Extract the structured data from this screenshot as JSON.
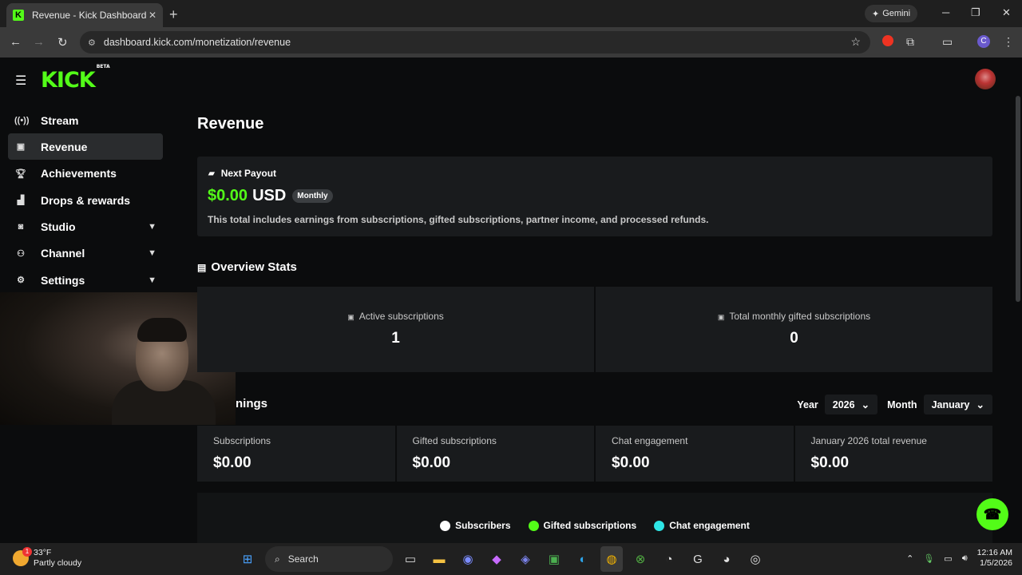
{
  "browser": {
    "tab_title": "Revenue - Kick Dashboard",
    "tab_close": "✕",
    "new_tab": "+",
    "gemini_label": "Gemini",
    "url": "dashboard.kick.com/monetization/revenue",
    "profile_letter": "C"
  },
  "app": {
    "logo": "KICK",
    "logo_badge": "BETA"
  },
  "sidebar": {
    "items": [
      {
        "label": "Stream",
        "icon": "broadcast-icon"
      },
      {
        "label": "Revenue",
        "icon": "chart-icon"
      },
      {
        "label": "Achievements",
        "icon": "trophy-icon"
      },
      {
        "label": "Drops & rewards",
        "icon": "gift-icon"
      },
      {
        "label": "Studio",
        "icon": "studio-icon"
      },
      {
        "label": "Channel",
        "icon": "users-icon"
      },
      {
        "label": "Settings",
        "icon": "gear-icon"
      }
    ]
  },
  "page": {
    "title": "Revenue"
  },
  "payout": {
    "heading": "Next Payout",
    "amount": "$0.00",
    "currency": "USD",
    "frequency": "Monthly",
    "description": "This total includes earnings from subscriptions, gifted subscriptions, partner income, and processed refunds."
  },
  "overview": {
    "title": "Overview Stats",
    "stats": [
      {
        "label": "Active subscriptions",
        "value": "1"
      },
      {
        "label": "Total monthly gifted subscriptions",
        "value": "0"
      }
    ]
  },
  "earnings": {
    "title_visible": "nings",
    "year_label": "Year",
    "year_value": "2026",
    "month_label": "Month",
    "month_value": "January",
    "cards": [
      {
        "label": "Subscriptions",
        "value": "$0.00"
      },
      {
        "label": "Gifted subscriptions",
        "value": "$0.00"
      },
      {
        "label": "Chat engagement",
        "value": "$0.00"
      },
      {
        "label": "January 2026 total revenue",
        "value": "$0.00"
      }
    ]
  },
  "legend": [
    {
      "label": "Subscribers",
      "color": "#ffffff"
    },
    {
      "label": "Gifted subscriptions",
      "color": "#53fc18"
    },
    {
      "label": "Chat engagement",
      "color": "#2ee6e6"
    }
  ],
  "colors": {
    "accent": "#53fc18",
    "background": "#0b0c0d",
    "card": "#191b1d"
  },
  "taskbar": {
    "temperature": "33°F",
    "condition": "Partly cloudy",
    "weather_badge": "1",
    "search_label": "Search",
    "time": "12:16 AM",
    "date": "1/5/2026"
  }
}
